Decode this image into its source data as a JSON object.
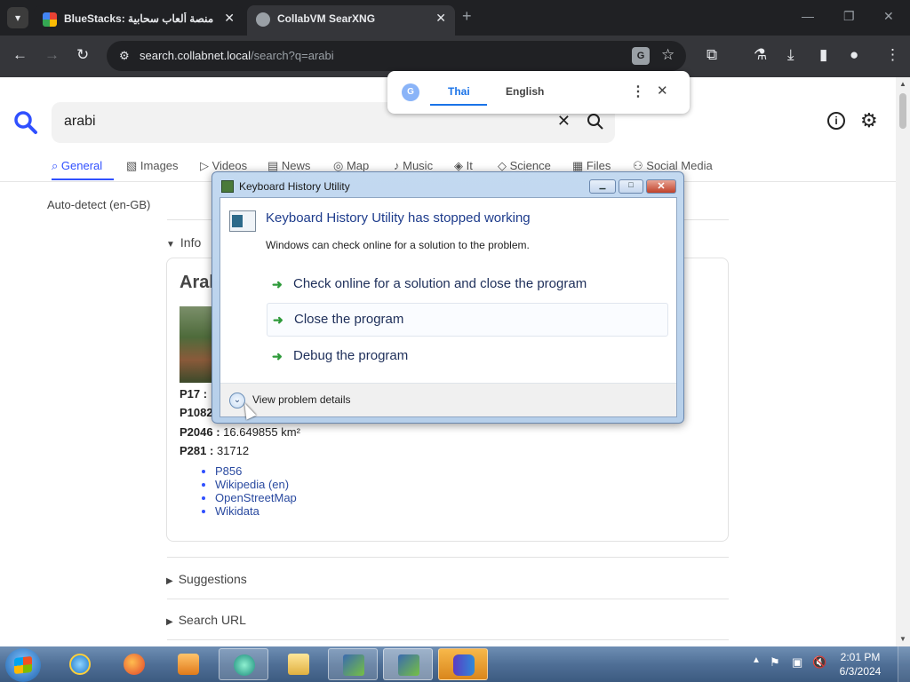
{
  "browser": {
    "tabs": [
      {
        "title": "BlueStacks: ويندوز، منصة ألعاب سحابية",
        "active": false
      },
      {
        "title": "CollabVM SearXNG",
        "active": true
      }
    ],
    "url_host": "search.collabnet.local",
    "url_path": "/search?q=arabi"
  },
  "translate_popup": {
    "tabs": [
      "Thai",
      "English"
    ],
    "selected": "Thai"
  },
  "search": {
    "query": "arabi",
    "categories": [
      {
        "label": "General",
        "icon": "search-icon",
        "active": true
      },
      {
        "label": "Images",
        "icon": "image-icon"
      },
      {
        "label": "Videos",
        "icon": "play-icon"
      },
      {
        "label": "News",
        "icon": "news-icon"
      },
      {
        "label": "Map",
        "icon": "pin-icon"
      },
      {
        "label": "Music",
        "icon": "music-icon"
      },
      {
        "label": "It",
        "icon": "layers-icon"
      },
      {
        "label": "Science",
        "icon": "science-icon"
      },
      {
        "label": "Files",
        "icon": "files-icon"
      },
      {
        "label": "Social Media",
        "icon": "people-icon"
      }
    ],
    "language": "Auto-detect (en-GB)",
    "sections": {
      "info": "Info",
      "suggestions": "Suggestions",
      "search_url": "Search URL"
    }
  },
  "infobox": {
    "title": "Arabi",
    "rows": [
      {
        "key": "P17 :",
        "value": ""
      },
      {
        "key": "P1082",
        "value": ""
      },
      {
        "key": "P2046 :",
        "value": "16.649855 km²"
      },
      {
        "key": "P281 :",
        "value": "31712"
      }
    ],
    "links": [
      "P856",
      "Wikipedia (en)",
      "OpenStreetMap",
      "Wikidata"
    ]
  },
  "dialog": {
    "title": "Keyboard History Utility",
    "heading": "Keyboard History Utility has stopped working",
    "subtext": "Windows can check online for a solution to the problem.",
    "options": [
      "Check online for a solution and close the program",
      "Close the program",
      "Debug the program"
    ],
    "details_label": "View problem details"
  },
  "taskbar": {
    "time": "2:01 PM",
    "date": "6/3/2024"
  }
}
